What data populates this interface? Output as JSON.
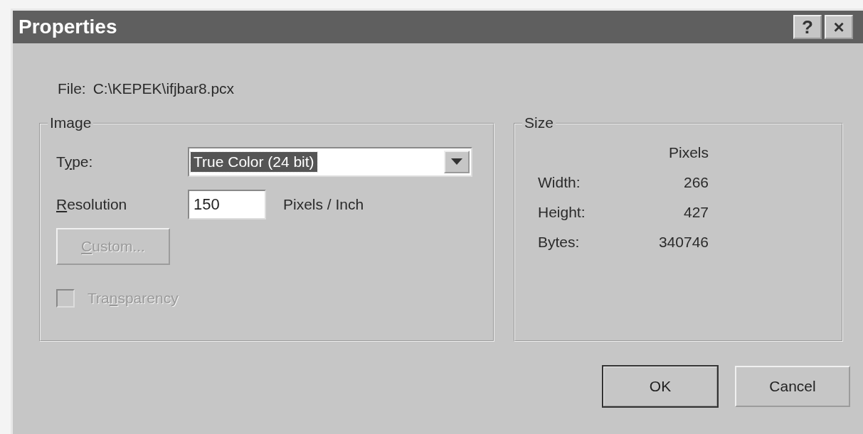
{
  "window": {
    "title": "Properties",
    "title_buttons": [
      "?",
      "×"
    ]
  },
  "file": {
    "label": "File:",
    "path": "C:\\KEPEK\\ifjbar8.pcx"
  },
  "image_group": {
    "title": "Image",
    "type": {
      "label_start": "T",
      "mnemonic": "y",
      "label_end": "pe:",
      "value": "True Color (24 bit)",
      "focused": true
    },
    "resolution": {
      "mnemonic": "R",
      "label_end": "esolution",
      "value": "150",
      "unit": "Pixels / Inch"
    },
    "custom_button": {
      "mnemonic": "C",
      "label_end": "ustom...",
      "disabled": true
    },
    "transparency": {
      "label_start": "Tra",
      "mnemonic": "n",
      "label_end": "sparency",
      "checked": false,
      "disabled": true
    }
  },
  "size_group": {
    "title": "Size",
    "column_header": "Pixels",
    "rows": [
      {
        "label": "Width:",
        "value": "266"
      },
      {
        "label": "Height:",
        "value": "427"
      },
      {
        "label": "Bytes:",
        "value": "340746"
      }
    ]
  },
  "buttons": [
    {
      "label": "OK",
      "default": true
    },
    {
      "label": "Cancel",
      "default": false
    }
  ]
}
